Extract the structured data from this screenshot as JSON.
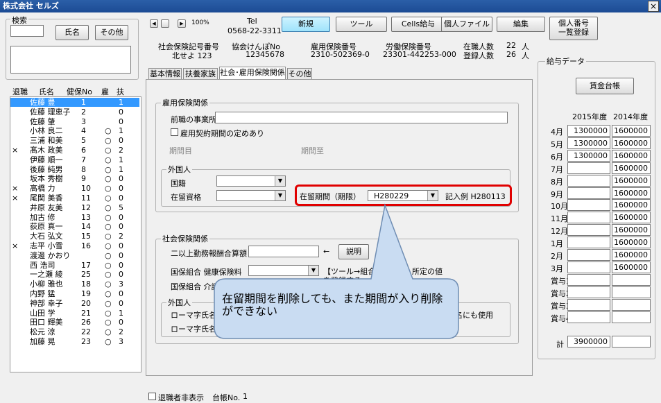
{
  "window": {
    "title": "株式会社 セルズ",
    "close": "×"
  },
  "search": {
    "label": "検索",
    "name_btn": "氏名",
    "other_btn": "その他"
  },
  "list": {
    "headers": [
      "退職",
      "氏名",
      "健保No",
      "雇",
      "扶"
    ],
    "rows": [
      {
        "ret": "",
        "name": "佐藤 豊",
        "no": "1",
        "emp": "",
        "dep": "1"
      },
      {
        "ret": "",
        "name": "佐藤 理恵子",
        "no": "2",
        "emp": "",
        "dep": "0"
      },
      {
        "ret": "",
        "name": "佐藤 肇",
        "no": "3",
        "emp": "",
        "dep": "0"
      },
      {
        "ret": "",
        "name": "小林 良二",
        "no": "4",
        "emp": "○",
        "dep": "1"
      },
      {
        "ret": "",
        "name": "三浦 和美",
        "no": "5",
        "emp": "○",
        "dep": "0"
      },
      {
        "ret": "×",
        "name": "髙木 政美",
        "no": "6",
        "emp": "○",
        "dep": "2"
      },
      {
        "ret": "",
        "name": "伊藤 順一",
        "no": "7",
        "emp": "○",
        "dep": "1"
      },
      {
        "ret": "",
        "name": "後藤 純男",
        "no": "8",
        "emp": "○",
        "dep": "1"
      },
      {
        "ret": "",
        "name": "坂本 秀樹",
        "no": "9",
        "emp": "○",
        "dep": "0"
      },
      {
        "ret": "×",
        "name": "高橋 力",
        "no": "10",
        "emp": "○",
        "dep": "0"
      },
      {
        "ret": "×",
        "name": "尾関 美香",
        "no": "11",
        "emp": "○",
        "dep": "0"
      },
      {
        "ret": "",
        "name": "井原 友美",
        "no": "12",
        "emp": "○",
        "dep": "5"
      },
      {
        "ret": "",
        "name": "加古 修",
        "no": "13",
        "emp": "○",
        "dep": "0"
      },
      {
        "ret": "",
        "name": "荻原 真一",
        "no": "14",
        "emp": "○",
        "dep": "0"
      },
      {
        "ret": "",
        "name": "大石 弘文",
        "no": "15",
        "emp": "○",
        "dep": "2"
      },
      {
        "ret": "×",
        "name": "志平 小雪",
        "no": "16",
        "emp": "○",
        "dep": "0"
      },
      {
        "ret": "",
        "name": "渡邊 かおり",
        "no": "",
        "emp": "○",
        "dep": "0"
      },
      {
        "ret": "",
        "name": "西 浩司",
        "no": "17",
        "emp": "○",
        "dep": "0"
      },
      {
        "ret": "",
        "name": "一之瀬 綾",
        "no": "25",
        "emp": "○",
        "dep": "0"
      },
      {
        "ret": "",
        "name": "小柳 雅也",
        "no": "18",
        "emp": "○",
        "dep": "3"
      },
      {
        "ret": "",
        "name": "内野 猛",
        "no": "19",
        "emp": "○",
        "dep": "0"
      },
      {
        "ret": "",
        "name": "神部 幸子",
        "no": "20",
        "emp": "○",
        "dep": "0"
      },
      {
        "ret": "",
        "name": "山田 学",
        "no": "21",
        "emp": "○",
        "dep": "1"
      },
      {
        "ret": "",
        "name": "田口 輝美",
        "no": "26",
        "emp": "○",
        "dep": "0"
      },
      {
        "ret": "",
        "name": "松元 涼",
        "no": "22",
        "emp": "○",
        "dep": "2"
      },
      {
        "ret": "",
        "name": "加藤 晃",
        "no": "23",
        "emp": "○",
        "dep": "3"
      }
    ]
  },
  "toolbar": {
    "zoom": "100%",
    "tel_label": "Tel",
    "tel": "0568-22-3311",
    "new": "新規",
    "tool": "ツール",
    "cells": "Cells給与",
    "personal_file": "個人ファイル",
    "edit": "編集",
    "mynumber_1": "個人番号",
    "mynumber_2": "一覧登録"
  },
  "info": {
    "shakai_label": "社会保険記号番号",
    "shakai": "北せよ 123",
    "kyokai_label": "協会けんぽNo",
    "kyokai": "12345678",
    "koyo_label": "雇用保険番号",
    "koyo": "2310-502369-0",
    "rodo_label": "労働保険番号",
    "rodo": "23301-442253-000",
    "zaishoku_label": "在職人数",
    "zaishoku": "22",
    "nin1": "人",
    "toroku_label": "登録人数",
    "toroku": "26",
    "nin2": "人"
  },
  "tabs": [
    "基本情報",
    "扶養家族",
    "社会･雇用保険関係",
    "その他"
  ],
  "koyo_section": {
    "title": "雇用保険関係",
    "prev_label": "前職の事業所",
    "contract_label": "雇用契約期間の定めあり",
    "from": "期間目",
    "to": "期間至"
  },
  "foreign": {
    "title": "外国人",
    "nationality": "国籍",
    "status": "在留資格",
    "period_label": "在留期間（期限）",
    "period_value": "H280229",
    "example": "記入例 H280113"
  },
  "shakai_section": {
    "title": "社会保険関係",
    "multi": "二以上勤務報酬合算額",
    "arrow": "←",
    "explain": "説明",
    "kokuho1": "国保組合 健康保険料",
    "note1": "【ツール→組合",
    "note2": "所定の値",
    "note3": "を登録する",
    "kokuho2": "国保組合 介護",
    "foreign_title": "外国人",
    "roma1": "ローマ字氏名",
    "roma2": "ローマ字氏名",
    "note4": "名にも使用"
  },
  "callout": {
    "text": "在留期間を削除しても、また期間が入り削除ができない"
  },
  "salary": {
    "title": "給与データ",
    "ledger": "賃金台帳",
    "years": [
      "2015年度",
      "2014年度"
    ],
    "rows": [
      {
        "m": "4月",
        "a": "1300000",
        "b": "1600000"
      },
      {
        "m": "5月",
        "a": "1300000",
        "b": "1600000"
      },
      {
        "m": "6月",
        "a": "1300000",
        "b": "1600000"
      },
      {
        "m": "7月",
        "a": "",
        "b": "1600000"
      },
      {
        "m": "8月",
        "a": "",
        "b": "1600000"
      },
      {
        "m": "9月",
        "a": "",
        "b": "1600000"
      },
      {
        "m": "10月",
        "a": "",
        "b": "1600000"
      },
      {
        "m": "11月",
        "a": "",
        "b": "1600000"
      },
      {
        "m": "12月",
        "a": "",
        "b": "1600000"
      },
      {
        "m": "1月",
        "a": "",
        "b": "1600000"
      },
      {
        "m": "2月",
        "a": "",
        "b": "1600000"
      },
      {
        "m": "3月",
        "a": "",
        "b": "1600000"
      },
      {
        "m": "賞与1",
        "a": "",
        "b": ""
      },
      {
        "m": "賞与2",
        "a": "",
        "b": ""
      },
      {
        "m": "賞与3",
        "a": "",
        "b": ""
      },
      {
        "m": "賞与4",
        "a": "",
        "b": ""
      }
    ],
    "total_label": "計",
    "total": "3900000"
  },
  "footer": {
    "hide_retired": "退職者非表示",
    "ledger_label": "台帳No.",
    "ledger_no": "1"
  },
  "colors": {
    "titlebar": "#1c4b94",
    "selection": "#3399ff",
    "highlight": "#e00000",
    "callout": "#c9dcf2"
  }
}
